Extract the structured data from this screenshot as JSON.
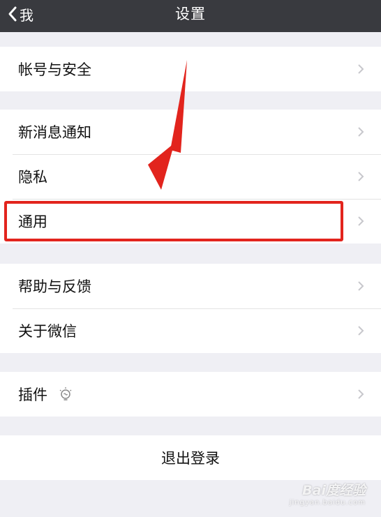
{
  "navbar": {
    "back_label": "我",
    "title": "设置"
  },
  "groups": [
    {
      "items": [
        {
          "label": "帐号与安全"
        }
      ]
    },
    {
      "items": [
        {
          "label": "新消息通知"
        },
        {
          "label": "隐私"
        },
        {
          "label": "通用"
        }
      ]
    },
    {
      "items": [
        {
          "label": "帮助与反馈"
        },
        {
          "label": "关于微信"
        }
      ]
    },
    {
      "items": [
        {
          "label": "插件"
        }
      ]
    }
  ],
  "logout_label": "退出登录",
  "annotation": {
    "highlighted_item": "通用",
    "color": "#e2241d"
  },
  "icons": {
    "back": "chevron-left-icon",
    "row": "chevron-right-icon",
    "plugin": "lightbulb-icon"
  },
  "watermark": {
    "main": "Bai度经验",
    "sub": "jingyan.baidu.com"
  }
}
